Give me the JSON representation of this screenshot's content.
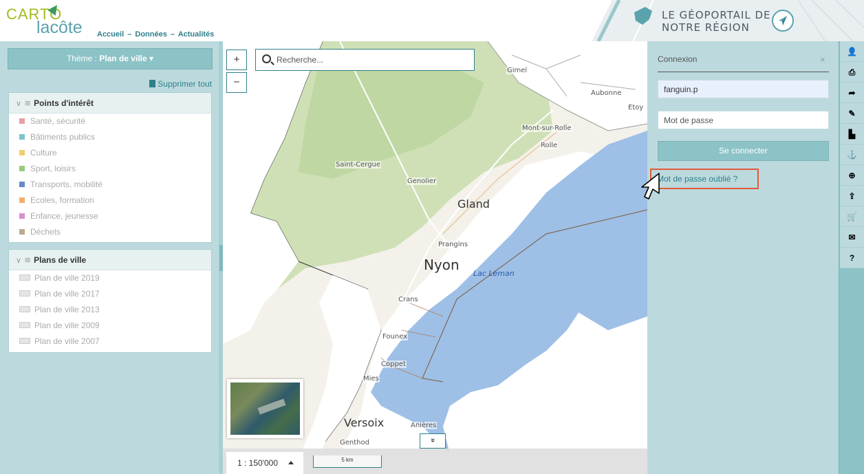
{
  "header": {
    "logo_top": "CARTO",
    "logo_bottom": "lacôte",
    "nav": {
      "home": "Accueil",
      "sep1": "–",
      "data": "Données",
      "sep2": "–",
      "news": "Actualités"
    },
    "banner_line1": "LE GÉOPORTAIL DE",
    "banner_line2": "NOTRE RÉGION"
  },
  "sidebar": {
    "theme_label": "Thème : ",
    "theme_value": "Plan de ville",
    "theme_caret": "▾",
    "delete_all": "Supprimer tout",
    "groups": [
      {
        "title": "Points d'intérêt",
        "items": [
          {
            "label": "Santé, sécurité",
            "color": "#e8a0a0"
          },
          {
            "label": "Bâtiments publics",
            "color": "#7cc3d0"
          },
          {
            "label": "Culture",
            "color": "#f0d070"
          },
          {
            "label": "Sport, loisirs",
            "color": "#98cc7c"
          },
          {
            "label": "Transports, mobilité",
            "color": "#6888c8"
          },
          {
            "label": "Ecoles, formation",
            "color": "#f0b070"
          },
          {
            "label": "Enfance, jeunesse",
            "color": "#d890d0"
          },
          {
            "label": "Déchets",
            "color": "#c0a890"
          }
        ]
      },
      {
        "title": "Plans de ville",
        "items": [
          {
            "label": "Plan de ville 2019"
          },
          {
            "label": "Plan de ville 2017"
          },
          {
            "label": "Plan de ville 2013"
          },
          {
            "label": "Plan de ville 2009"
          },
          {
            "label": "Plan de ville 2007"
          }
        ]
      }
    ],
    "collapse_glyph": "«"
  },
  "map": {
    "zoom_in": "+",
    "zoom_out": "−",
    "search_placeholder": "Recherche...",
    "places": {
      "gimel": "Gimel",
      "aubonne": "Aubonne",
      "etoy": "Etoy",
      "mont_sur_rolle": "Mont-sur-Rolle",
      "rolle": "Rolle",
      "saint_cergue": "Saint-Cergue",
      "genolier": "Genolier",
      "gland": "Gland",
      "prangins": "Prangins",
      "nyon": "Nyon",
      "lac_leman": "Lac Léman",
      "crans": "Crans",
      "founex": "Founex",
      "coppet": "Coppet",
      "mies": "Mies",
      "versoix": "Versoix",
      "anieres": "Anières",
      "genthod": "Genthod"
    },
    "expand_glyph": "»",
    "scale_value": "1 : 150'000",
    "scalebar_label": "5 km"
  },
  "login": {
    "title": "Connexion",
    "close": "×",
    "username_value": "fanguin.p",
    "password_placeholder": "Mot de passe",
    "connect_label": "Se connecter",
    "forgot_label": "Mot de passe oublié ?"
  },
  "toolbar": {
    "tools": [
      {
        "name": "user-icon",
        "glyph": "👤"
      },
      {
        "name": "print-icon",
        "glyph": "⎙"
      },
      {
        "name": "share-icon",
        "glyph": "➦"
      },
      {
        "name": "draw-icon",
        "glyph": "✎"
      },
      {
        "name": "chart-icon",
        "glyph": "▙"
      },
      {
        "name": "anchor-icon",
        "glyph": "⚓"
      },
      {
        "name": "zoom-icon",
        "glyph": "⊕"
      },
      {
        "name": "upload-icon",
        "glyph": "⇪"
      },
      {
        "name": "cart-icon",
        "glyph": "🛒"
      },
      {
        "name": "mail-icon",
        "glyph": "✉"
      },
      {
        "name": "help-icon",
        "glyph": "?"
      }
    ]
  },
  "colors": {
    "accent": "#2f7f8b",
    "panel": "#bcdadd",
    "button": "#8cc3c7",
    "lake": "#9ebfe6",
    "highlight": "#e05a3a"
  }
}
